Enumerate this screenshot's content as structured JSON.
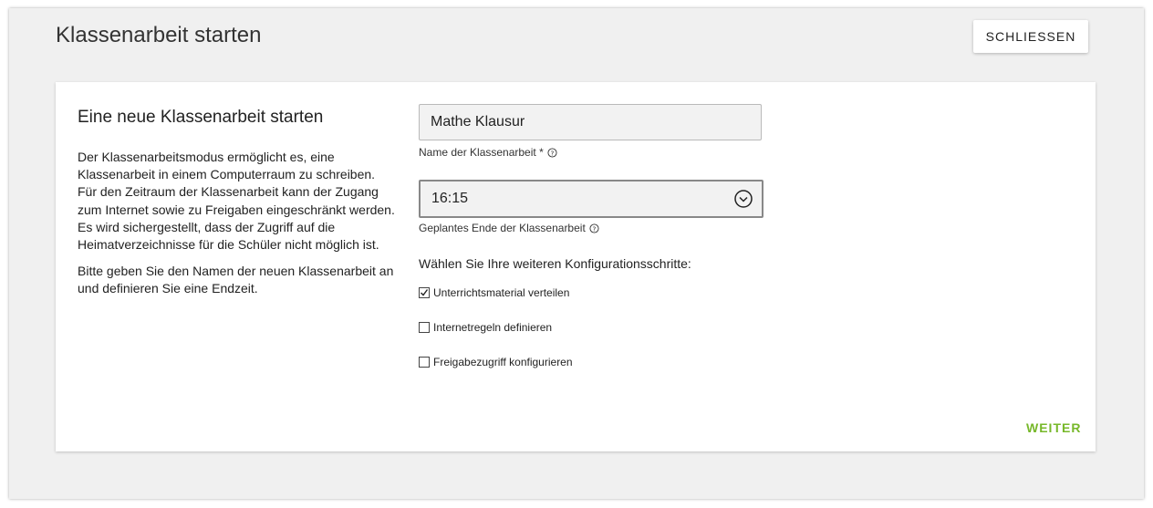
{
  "header": {
    "title": "Klassenarbeit starten",
    "close_label": "SCHLIESSEN"
  },
  "card": {
    "heading": "Eine neue Klassenarbeit starten",
    "description_1": "Der Klassenarbeitsmodus ermöglicht es, eine Klassenarbeit in einem Computerraum zu schreiben. Für den Zeitraum der Klassenarbeit kann der Zugang zum Internet sowie zu Freigaben eingeschränkt werden. Es wird sichergestellt, dass der Zugriff auf die Heimatverzeichnisse für die Schüler nicht möglich ist.",
    "description_2": "Bitte geben Sie den Namen der neuen Klassenarbeit an und definieren Sie eine Endzeit."
  },
  "form": {
    "name_value": "Mathe Klausur",
    "name_label": "Name der Klassenarbeit *",
    "end_time_value": "16:15",
    "end_time_label": "Geplantes Ende der Klassenarbeit",
    "steps_title": "Wählen Sie Ihre weiteren Konfigurationsschritte:",
    "steps": [
      {
        "label": "Unterrichtsmaterial verteilen",
        "checked": true
      },
      {
        "label": "Internetregeln definieren",
        "checked": false
      },
      {
        "label": "Freigabezugriff konfigurieren",
        "checked": false
      }
    ]
  },
  "footer": {
    "next_label": "WEITER"
  },
  "colors": {
    "accent": "#77b82a",
    "background": "#f0f0f0"
  },
  "icons": {
    "help": "help-circle-icon",
    "time_dropdown": "chevron-down-circle-icon"
  }
}
